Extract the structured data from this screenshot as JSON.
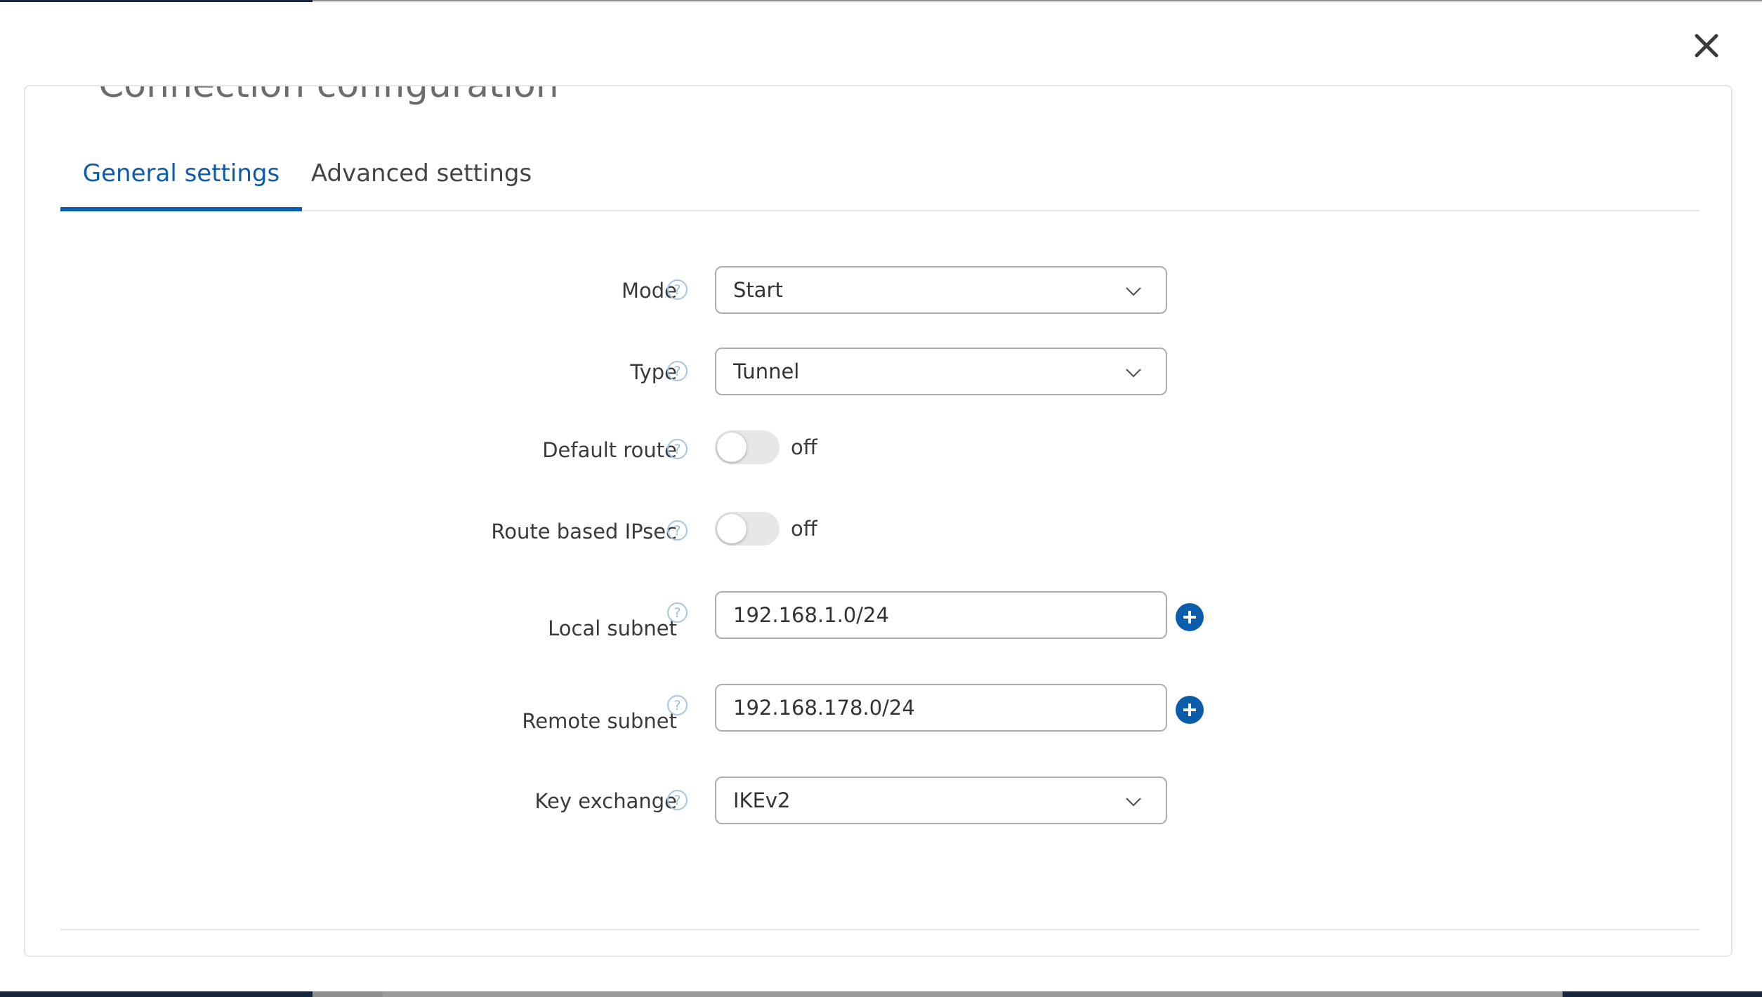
{
  "dialog": {
    "section_title": "Connection configuration",
    "close_icon": "close-icon"
  },
  "tabs": [
    {
      "label": "General settings",
      "active": true
    },
    {
      "label": "Advanced settings",
      "active": false
    }
  ],
  "form": {
    "mode": {
      "label": "Mode",
      "value": "Start"
    },
    "type": {
      "label": "Type",
      "value": "Tunnel"
    },
    "default_route": {
      "label": "Default route",
      "state": "off"
    },
    "route_based_ipsec": {
      "label": "Route based IPsec",
      "state": "off"
    },
    "local_subnet": {
      "label": "Local subnet",
      "value": "192.168.1.0/24"
    },
    "remote_subnet": {
      "label": "Remote subnet",
      "value": "192.168.178.0/24"
    },
    "key_exchange": {
      "label": "Key exchange",
      "value": "IKEv2"
    },
    "help_glyph": "?"
  },
  "colors": {
    "accent": "#0c5cac",
    "border": "#adadad",
    "toggle_off": "#e7e7e7"
  }
}
